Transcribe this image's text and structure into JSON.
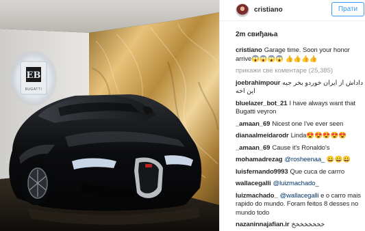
{
  "post": {
    "username": "cristiano",
    "follow_label": "Прати",
    "time_ago": "2m свиђања",
    "view_all_comments": "прикажи све коментаре (25,385)"
  },
  "comments": [
    {
      "user": "cristiano",
      "text": "Garage time. Soon your honor arrive😱😱😱😱 👍👍👍👍",
      "mention": ""
    },
    {
      "user": "joebrahimpour",
      "text": "داداش از ایران خوردو بخر جیه این اخه",
      "mention": ""
    },
    {
      "user": "bluelazer_bot_21",
      "text": "I have always want that Bugatti veyron",
      "mention": ""
    },
    {
      "user": "_amaan_69",
      "text": "Nicest one I've ever seen",
      "mention": ""
    },
    {
      "user": "dianaalmeidarodr",
      "text": "Linda😍😍😍😍😍",
      "mention": ""
    },
    {
      "user": "_amaan_69",
      "text": "Cause it's Ronaldo's",
      "mention": ""
    },
    {
      "user": "mohamadrezag",
      "text": "",
      "mention": "@rosheenaa_",
      "suffix": " 😀😀😀"
    },
    {
      "user": "luisfernando9993",
      "text": "Que cuca de carrro",
      "mention": ""
    },
    {
      "user": "wallacegalli",
      "text": "",
      "mention": "@luizmachado_"
    },
    {
      "user": "luizmachado_",
      "text": "",
      "mention": "@wallacegalli",
      "suffix": " e o carro mais rapido do mundo. Foram feitos 8 desses no mundo todo"
    },
    {
      "user": "nazaninnajafian.ir",
      "text": "خخخخخخخخ",
      "mention": ""
    }
  ],
  "photo": {
    "wall_badge_text": "BUGATTI",
    "wall_badge_icon": "eb-logo-icon"
  }
}
